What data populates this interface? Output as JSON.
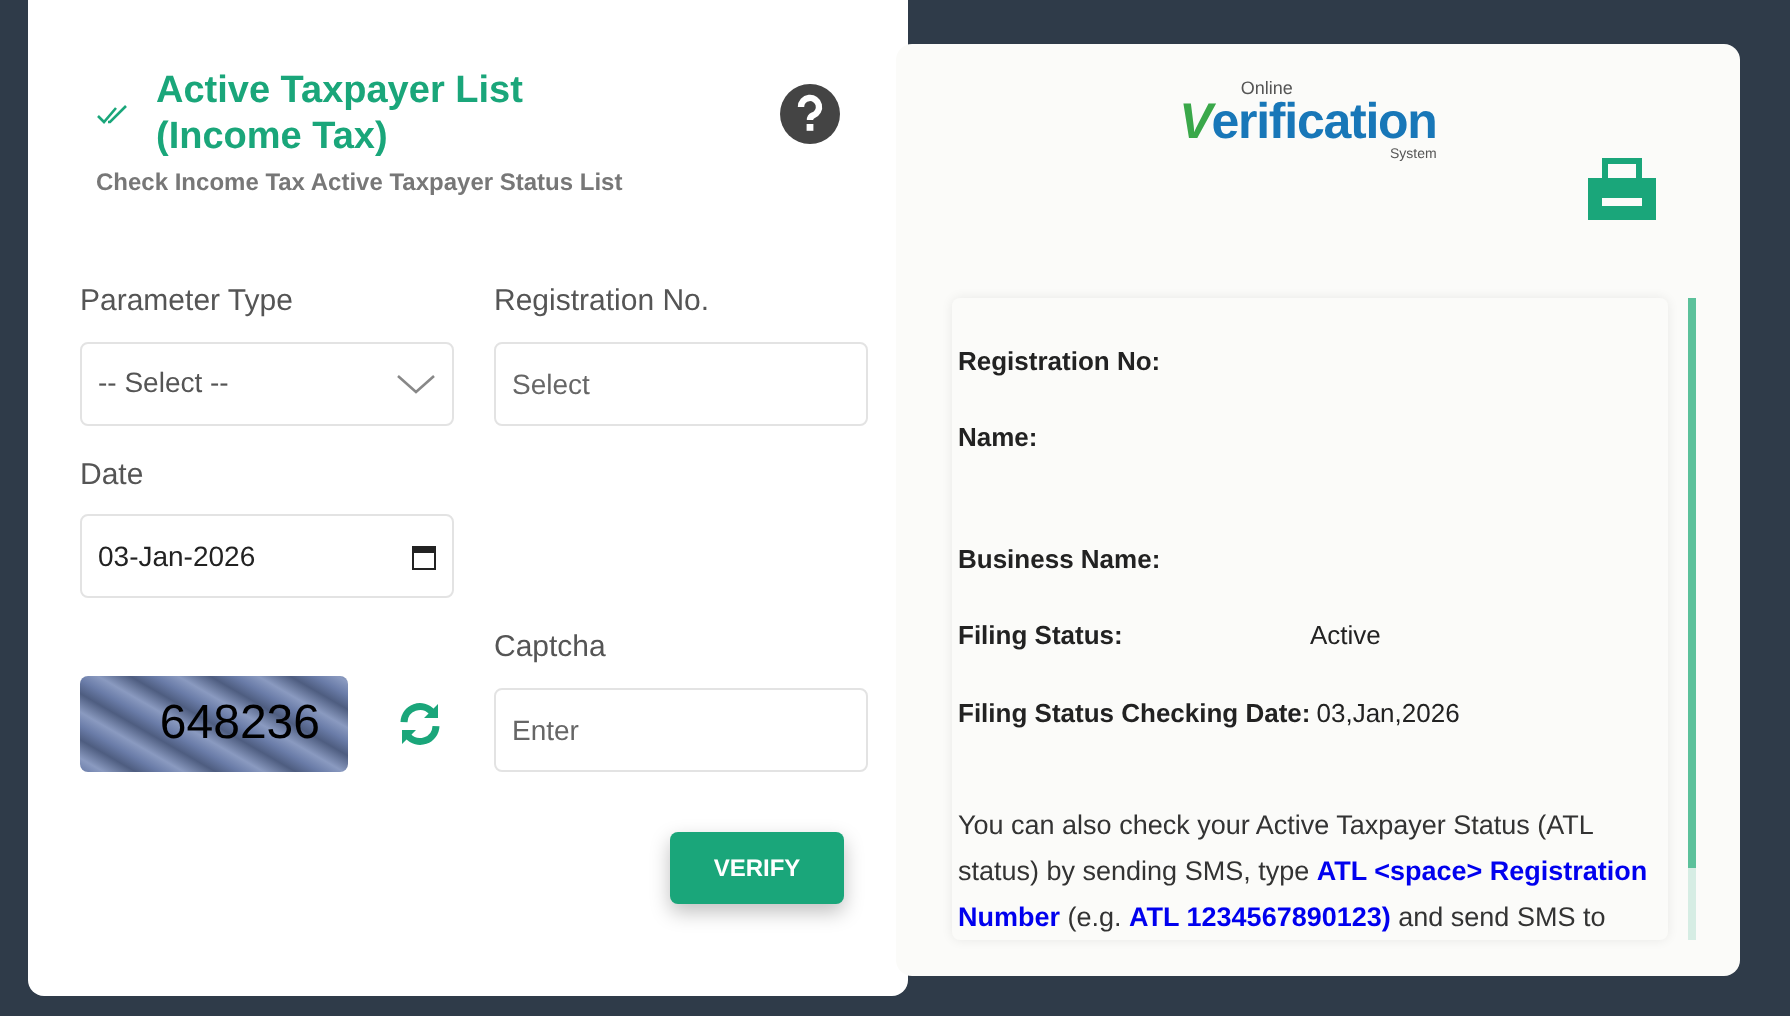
{
  "header": {
    "title": "Active Taxpayer List (Income Tax)",
    "subtitle": "Check Income Tax Active Taxpayer Status List"
  },
  "form": {
    "parameter_type": {
      "label": "Parameter Type",
      "value": "-- Select --"
    },
    "registration_no": {
      "label": "Registration No.",
      "placeholder": "Select"
    },
    "date": {
      "label": "Date",
      "value": "03-Jan-2026"
    },
    "captcha_image": "648236",
    "captcha": {
      "label": "Captcha",
      "placeholder": "Enter"
    },
    "verify_button": "VERIFY"
  },
  "logo": {
    "top": "Online",
    "first_letter": "V",
    "rest": "erification",
    "bottom": "System"
  },
  "result": {
    "rows": [
      {
        "label": "Registration No:"
      },
      {
        "label": "Name:"
      },
      {
        "label": "Business Name:"
      },
      {
        "label": "Filing Status:",
        "value": "Active"
      },
      {
        "label": "Filing Status Checking Date:",
        "value": "03,Jan,2026"
      }
    ],
    "note": "You can also check your Active Taxpayer Status (ATL status) by sending SMS, type **ATL <space> Registration Number** (e.g. **ATL 1234567890123)** and send SMS to"
  }
}
